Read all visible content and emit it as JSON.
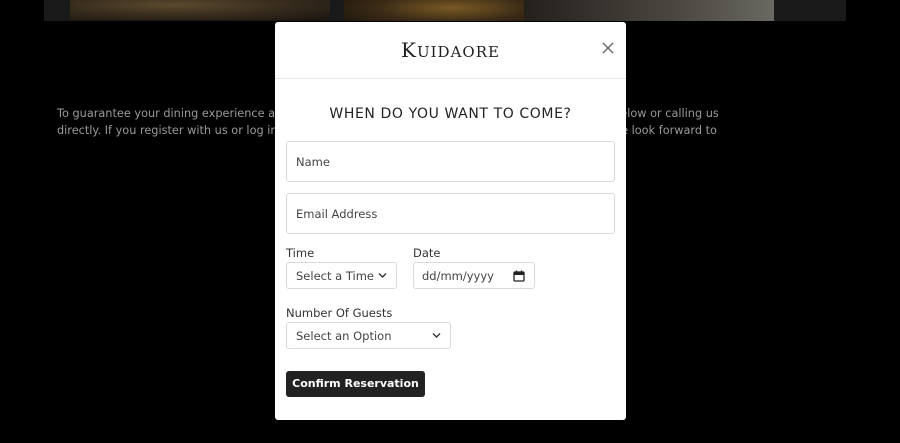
{
  "background": {
    "intro_line1": "To guarantee your dining experience at Kuidaore, we recommend you secure a table by reserving below or calling us",
    "intro_line2": "directly. If you register with us or log in you can save your details and view booking availabilities. We look forward to"
  },
  "modal": {
    "brand": "Kuidaore",
    "title": "WHEN DO YOU WANT TO COME?",
    "name_placeholder": "Name",
    "email_placeholder": "Email Address",
    "time_label": "Time",
    "time_value": "Select a Time",
    "date_label": "Date",
    "date_value": "dd/mm/yyyy",
    "guests_label": "Number Of Guests",
    "guests_value": "Select an Option",
    "confirm_label": "Confirm Reservation"
  },
  "icons": [
    "close-icon",
    "chevron-down-icon",
    "calendar-icon"
  ]
}
